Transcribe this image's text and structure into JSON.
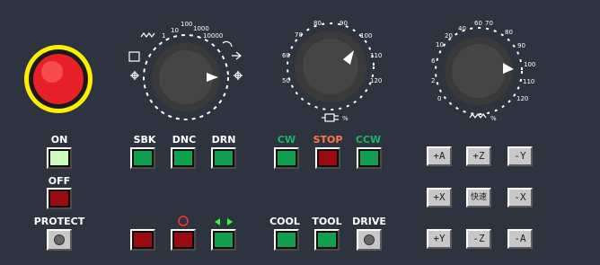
{
  "mode_buttons": {
    "on": "ON",
    "off": "OFF",
    "protect": "PROTECT"
  },
  "func_buttons": {
    "sbk": "SBK",
    "dnc": "DNC",
    "drn": "DRN",
    "cw": "CW",
    "stop": "STOP",
    "ccw": "CCW",
    "cool": "COOL",
    "tool": "TOOL",
    "drive": "DRIVE"
  },
  "jog_buttons": {
    "plus_a": "+A",
    "plus_z": "+Z",
    "minus_y": "-Y",
    "plus_x": "+X",
    "rapid": "快速",
    "minus_x": "-X",
    "plus_y": "+Y",
    "minus_z": "-Z",
    "minus_a": "-A"
  },
  "knob_mode": {
    "ticks": [
      "1",
      "10",
      "100",
      "1000",
      "10000"
    ]
  },
  "knob_spindle": {
    "ticks": [
      "50",
      "60",
      "70",
      "80",
      "90",
      "100",
      "110",
      "120"
    ],
    "unit": "%"
  },
  "knob_feed": {
    "ticks": [
      "0",
      "2",
      "6",
      "10",
      "20",
      "40",
      "60",
      "70",
      "80",
      "90",
      "100",
      "110",
      "120"
    ],
    "unit": "%"
  },
  "colors": {
    "panel": "#2e3340",
    "green": "#11a050",
    "red": "#9a0a10",
    "estop": "#ff1a1a",
    "estop_ring": "#ffee00",
    "cw_label": "#18b860",
    "stop_label": "#ff7744"
  }
}
